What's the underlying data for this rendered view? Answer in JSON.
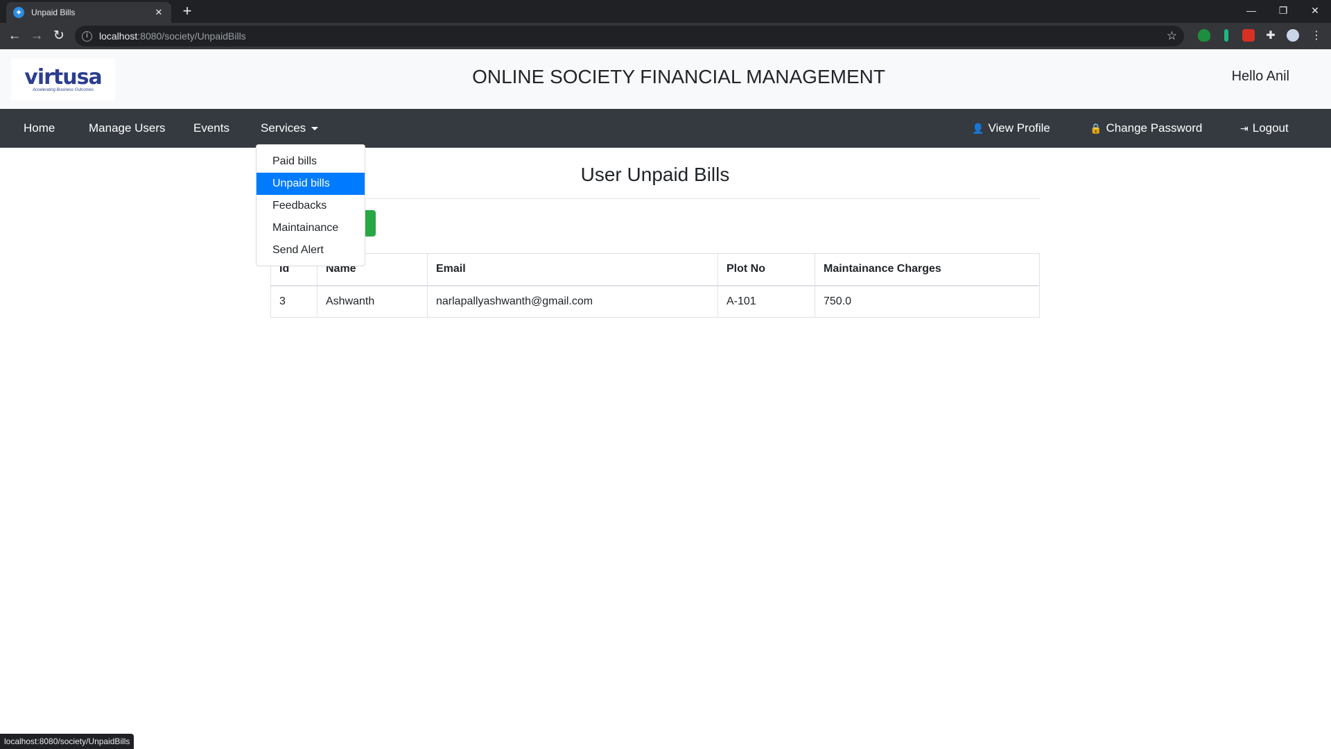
{
  "browser": {
    "tab_title": "Unpaid Bills",
    "url_host": "localhost",
    "url_rest": ":8080/society/UnpaidBills",
    "status_url": "localhost:8080/society/UnpaidBills"
  },
  "header": {
    "logo_text": "virtusa",
    "logo_tagline": "Accelerating Business Outcomes",
    "title": "ONLINE SOCIETY FINANCIAL MANAGEMENT",
    "greeting": "Hello Anil"
  },
  "nav": {
    "home": "Home",
    "manage_users": "Manage Users",
    "events": "Events",
    "services": "Services",
    "view_profile": "View Profile",
    "change_password": "Change Password",
    "logout": "Logout"
  },
  "dropdown": {
    "items": [
      "Paid bills",
      "Unpaid bills",
      "Feedbacks",
      "Maintainance",
      "Send Alert"
    ],
    "active_index": 1
  },
  "main": {
    "heading": "User Unpaid Bills"
  },
  "table": {
    "headers": [
      "Id",
      "Name",
      "Email",
      "Plot No",
      "Maintainance Charges"
    ],
    "rows": [
      [
        "3",
        "Ashwanth",
        "narlapallyashwanth@gmail.com",
        "A-101",
        "750.0"
      ]
    ]
  },
  "colors": {
    "navbar": "#343a40",
    "active_item": "#007bff",
    "button": "#28a745"
  }
}
